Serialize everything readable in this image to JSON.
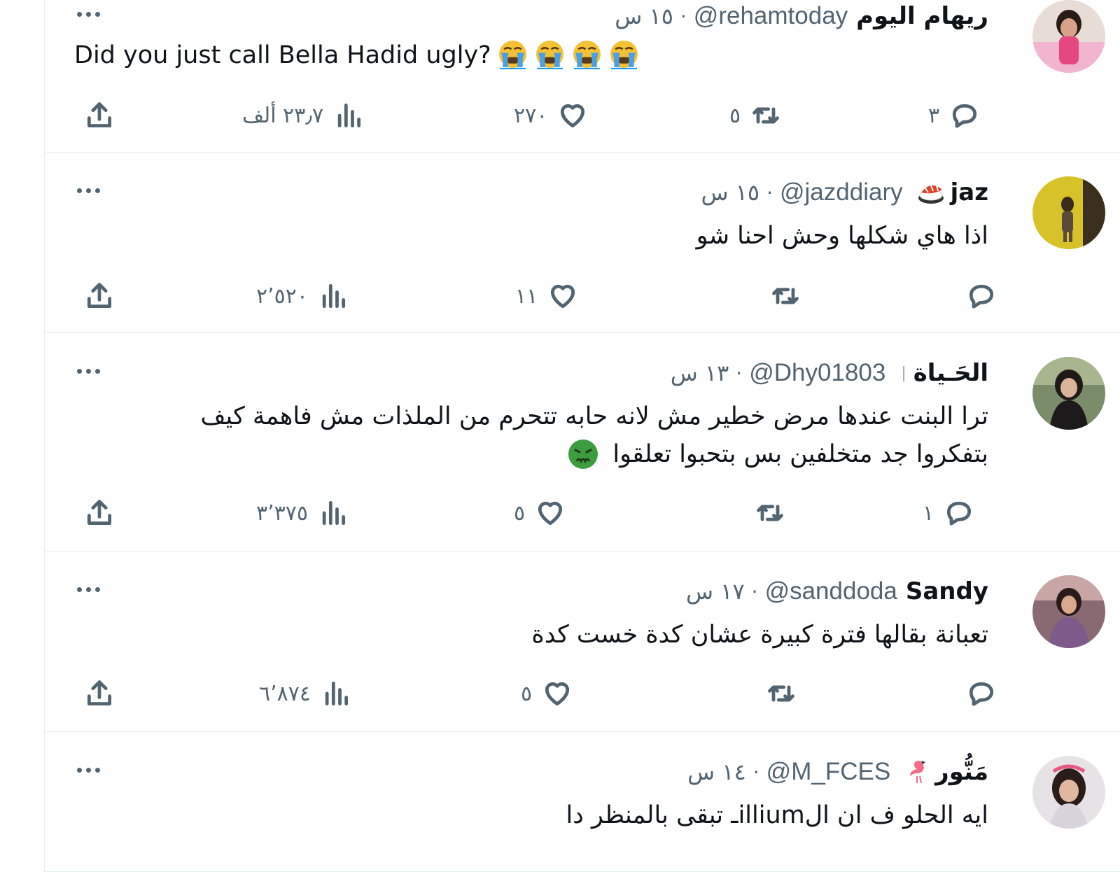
{
  "colors": {
    "text": "#0f1419",
    "secondary": "#536471",
    "divider": "#e6ecf0"
  },
  "tweets": [
    {
      "name": "ريهام اليوم",
      "name_emoji": "",
      "handle": "@rehamtoday",
      "separator": "·",
      "time": "١٥ س",
      "text": "Did you just call Bella Hadid ugly?",
      "trailing_emoji": "😭😭😭😭",
      "replies": "٣",
      "retweets": "٥",
      "likes": "٢٧٠",
      "views": "٢٣٫٧ ألف"
    },
    {
      "name": "jaz",
      "name_emoji": "🍣",
      "handle": "@jazddiary",
      "separator": "·",
      "time": "١٥ س",
      "text": "اذا هاي شكلها وحش احنا شو",
      "replies": "",
      "retweets": "",
      "likes": "١١",
      "views": "٢٬٥٢٠"
    },
    {
      "name": "الحَـياة",
      "name_emoji": "|",
      "handle": "@Dhy01803",
      "separator": "·",
      "time": "١٣ س",
      "text_lines": [
        "ترا البنت عندها مرض خطير مش لانه حابه تتحرم من الملذات مش فاهمة كيف",
        "بتفكروا جد متخلفين بس بتحبوا تعلقوا"
      ],
      "trailing_emoji": "🤢",
      "replies": "١",
      "retweets": "",
      "likes": "٥",
      "views": "٣٬٣٧٥"
    },
    {
      "name": "Sandy",
      "name_emoji": "",
      "handle": "@sanddoda",
      "separator": "·",
      "time": "١٧ س",
      "text": "تعبانة بقالها فترة كبيرة عشان كدة خست كدة",
      "replies": "",
      "retweets": "",
      "likes": "٥",
      "views": "٦٬٨٧٤"
    },
    {
      "name": "مَنُّور",
      "name_emoji": "🦩",
      "handle": "@M_FCES",
      "separator": "·",
      "time": "١٤ س",
      "text": "ايه الحلو ف ان الilliumـ تبقى بالمنظر دا"
    }
  ],
  "icons": [
    "reply-icon",
    "retweet-icon",
    "like-icon",
    "views-icon",
    "share-icon",
    "more-icon"
  ]
}
